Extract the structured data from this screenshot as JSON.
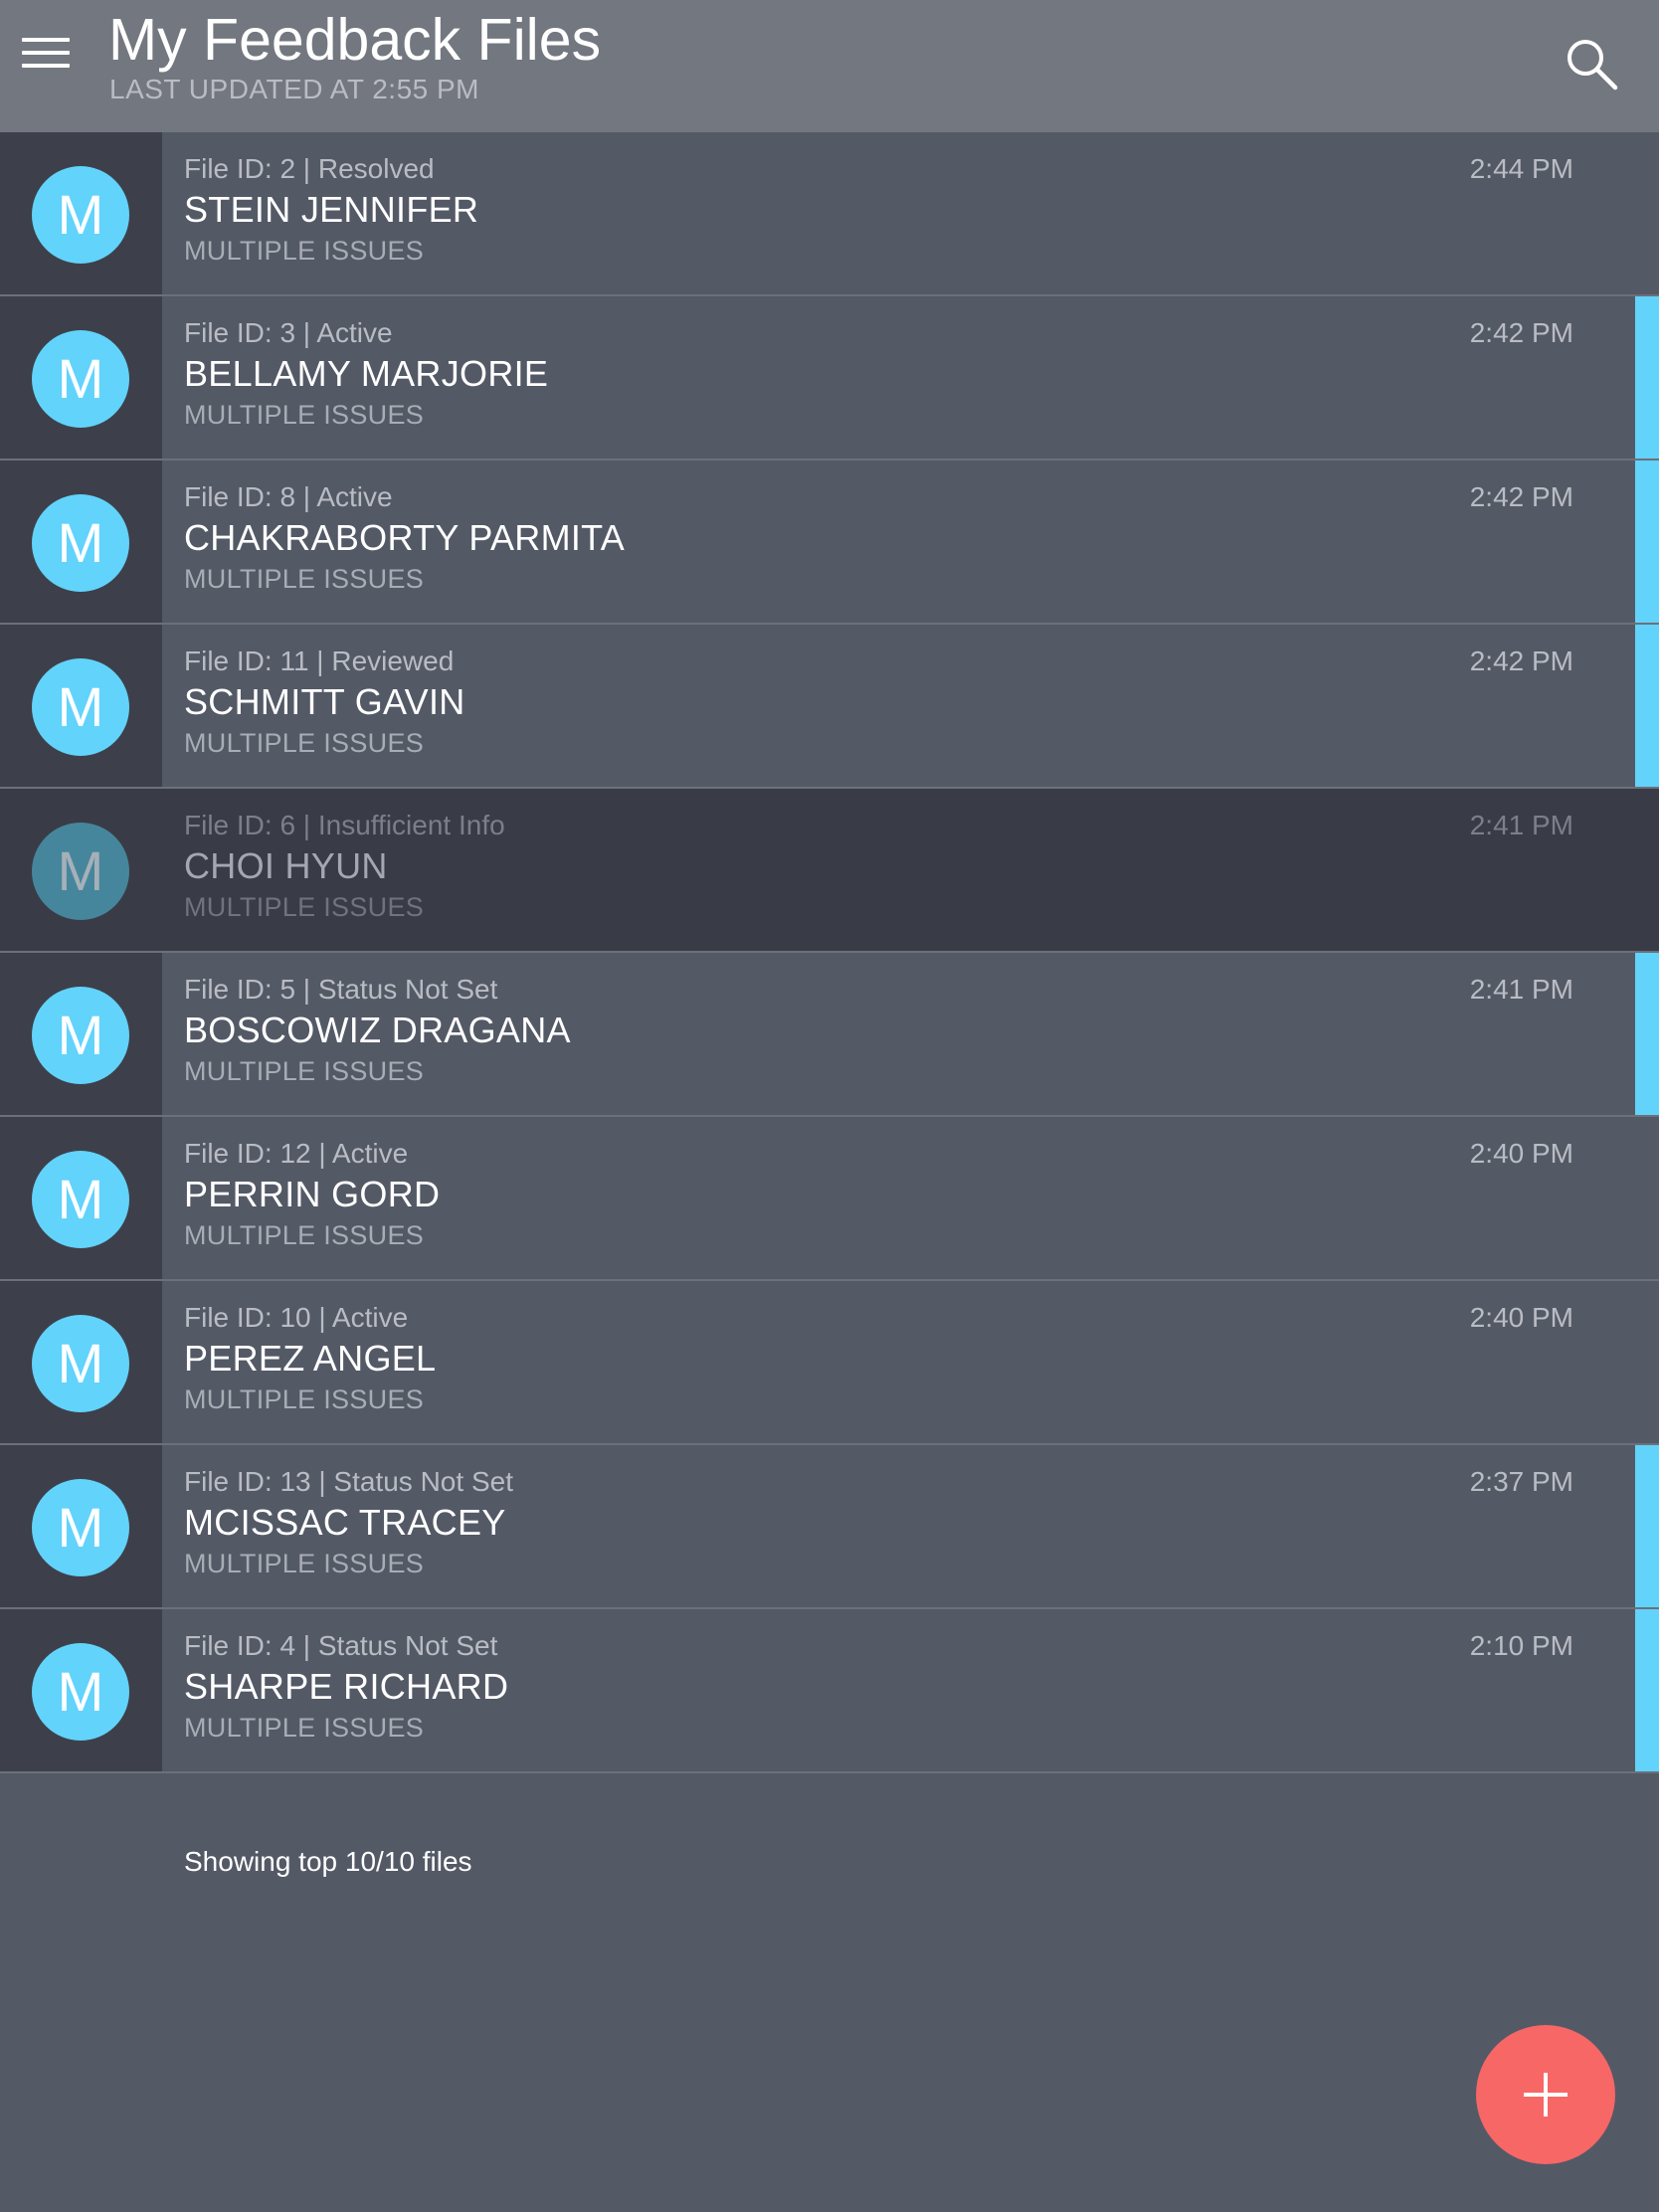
{
  "header": {
    "title": "My Feedback Files",
    "subtitle": "LAST UPDATED AT 2:55 PM",
    "menu_icon": "hamburger-menu-icon",
    "search_icon": "search-icon"
  },
  "files": [
    {
      "avatar": "M",
      "meta": "File ID: 2 | Resolved",
      "name": "STEIN JENNIFER",
      "issue": "MULTIPLE ISSUES",
      "time": "2:44 PM",
      "accent": false,
      "dim": false
    },
    {
      "avatar": "M",
      "meta": "File ID: 3 | Active",
      "name": "BELLAMY MARJORIE",
      "issue": "MULTIPLE ISSUES",
      "time": "2:42 PM",
      "accent": true,
      "dim": false
    },
    {
      "avatar": "M",
      "meta": "File ID: 8 | Active",
      "name": "CHAKRABORTY PARMITA",
      "issue": "MULTIPLE ISSUES",
      "time": "2:42 PM",
      "accent": true,
      "dim": false
    },
    {
      "avatar": "M",
      "meta": "File ID: 11 | Reviewed",
      "name": "SCHMITT GAVIN",
      "issue": "MULTIPLE ISSUES",
      "time": "2:42 PM",
      "accent": true,
      "dim": false
    },
    {
      "avatar": "M",
      "meta": "File ID: 6 | Insufficient Info",
      "name": "CHOI HYUN",
      "issue": "MULTIPLE ISSUES",
      "time": "2:41 PM",
      "accent": false,
      "dim": true
    },
    {
      "avatar": "M",
      "meta": "File ID: 5 | Status Not Set",
      "name": "BOSCOWIZ DRAGANA",
      "issue": "MULTIPLE ISSUES",
      "time": "2:41 PM",
      "accent": true,
      "dim": false
    },
    {
      "avatar": "M",
      "meta": "File ID: 12 | Active",
      "name": "PERRIN GORD",
      "issue": "MULTIPLE ISSUES",
      "time": "2:40 PM",
      "accent": false,
      "dim": false
    },
    {
      "avatar": "M",
      "meta": "File ID: 10 | Active",
      "name": "PEREZ ANGEL",
      "issue": "MULTIPLE ISSUES",
      "time": "2:40 PM",
      "accent": false,
      "dim": false
    },
    {
      "avatar": "M",
      "meta": "File ID: 13 | Status Not Set",
      "name": "MCISSAC TRACEY",
      "issue": "MULTIPLE ISSUES",
      "time": "2:37 PM",
      "accent": true,
      "dim": false
    },
    {
      "avatar": "M",
      "meta": "File ID: 4 | Status Not Set",
      "name": "SHARPE RICHARD",
      "issue": "MULTIPLE ISSUES",
      "time": "2:10 PM",
      "accent": true,
      "dim": false
    }
  ],
  "footer": {
    "summary": "Showing top 10/10 files"
  },
  "fab": {
    "icon": "plus-icon"
  },
  "colors": {
    "app_bar": "#737780",
    "background": "#545966",
    "row_gutter": "#3d404a",
    "dim_row": "#393c46",
    "avatar": "#62d3fb",
    "accent": "#62d3fb",
    "fab": "#f66766"
  }
}
